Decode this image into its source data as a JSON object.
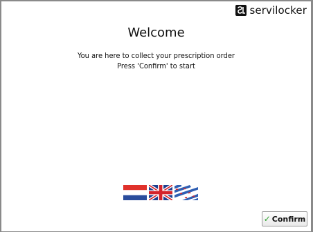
{
  "brand": {
    "name": "servilocker",
    "icon": "servilocker-logo-icon"
  },
  "welcome": {
    "title": "Welcome",
    "line1": "You are here to collect your prescription order",
    "line2": "Press 'Confirm' to start"
  },
  "languages": [
    {
      "name": "flag-netherlands",
      "icon": "netherlands-flag-icon"
    },
    {
      "name": "flag-united-kingdom",
      "icon": "uk-flag-icon"
    },
    {
      "name": "flag-friesland",
      "icon": "friesland-flag-icon"
    }
  ],
  "confirm": {
    "label": "Confirm",
    "icon": "checkmark-icon",
    "icon_color": "#2ea12e"
  }
}
